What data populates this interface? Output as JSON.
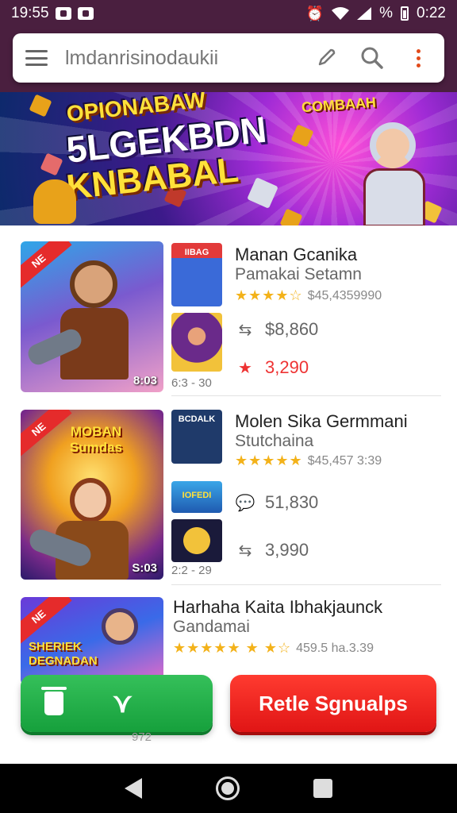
{
  "status_bar": {
    "time": "19:55",
    "battery_text": "%",
    "clock": "0:22"
  },
  "search": {
    "query": "lmdanrisinodaukii"
  },
  "banner": {
    "line1": "OPIONABAW",
    "line2": "5LGEKBDN",
    "line3": "KNBABAL",
    "badge": "COMBAAH"
  },
  "apps": [
    {
      "ribbon": "NE",
      "thumb_counter": "8:03",
      "small_caption": "6:3 - 30",
      "small_thumbs": [
        "IIBAG",
        ""
      ],
      "title": "Manan Gcanika",
      "subtitle": "Pamakai Setamn",
      "stars": "★★★★☆",
      "rating_text": "$45,4359990",
      "stats": [
        {
          "icon": "retweet-icon",
          "value": "$8,860"
        },
        {
          "icon": "star-icon",
          "value": "3,290"
        }
      ]
    },
    {
      "ribbon": "NE",
      "thumb_counter": "S:03",
      "small_caption": "2:2 - 29",
      "small_thumbs": [
        "BCDALK",
        "IOFEDI",
        ""
      ],
      "art_text": "MOBAN Sumdas",
      "title": "Molen Sika Germmani",
      "subtitle": "Stutchaina",
      "stars": "★★★★★",
      "rating_text": "$45,457 3:39",
      "stats": [
        {
          "icon": "chat-icon",
          "value": "51,830"
        },
        {
          "icon": "retweet-icon",
          "value": "3,990"
        }
      ]
    },
    {
      "ribbon": "NE",
      "art_text": "SHERIEK DEGNADAN",
      "title": "Harhaha Kaita Ibhakjaunck",
      "subtitle": "Gandamai",
      "stars": "★★★★★ ★ ★☆",
      "rating_text": "459.5 ha.3.39"
    }
  ],
  "actions": {
    "red_label": "Retle Sgnualps",
    "ghost_text": "972"
  }
}
